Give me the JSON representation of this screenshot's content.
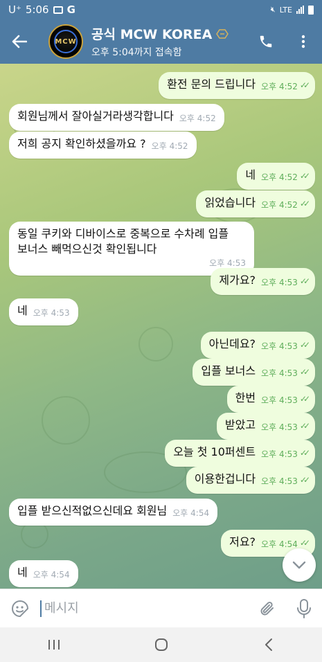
{
  "status_bar": {
    "carrier": "U⁺",
    "time": "5:06",
    "g_label": "G",
    "network": "LTE"
  },
  "header": {
    "title": "공식 MCW KOREA",
    "status": "오후 5:04까지 접속함",
    "avatar_text": "MCW",
    "accent": "#4e7ba3"
  },
  "messages": [
    {
      "dir": "out",
      "text": "환전 문의 드립니다",
      "time": "오후 4:52",
      "ticks": "✓✓"
    },
    {
      "dir": "in",
      "text": "회원님께서 잘아실거라생각합니다",
      "time": "오후 4:52"
    },
    {
      "dir": "in",
      "text": "저희 공지 확인하셨을까요 ?",
      "time": "오후 4:52"
    },
    {
      "dir": "out",
      "text": "네",
      "time": "오후 4:52",
      "ticks": "✓✓"
    },
    {
      "dir": "out",
      "text": "읽었습니다",
      "time": "오후 4:52",
      "ticks": "✓✓"
    },
    {
      "dir": "in",
      "text_line1": "동일 쿠키와 디바이스로 중복으로 수차례 입플",
      "text_line2": "보너스 빼먹으신것 확인됩니다",
      "time": "오후 4:53"
    },
    {
      "dir": "out",
      "text": "제가요?",
      "time": "오후 4:53",
      "ticks": "✓✓"
    },
    {
      "dir": "in",
      "text": "네",
      "time": "오후 4:53"
    },
    {
      "dir": "out",
      "text": "아닌데요?",
      "time": "오후 4:53",
      "ticks": "✓✓"
    },
    {
      "dir": "out",
      "text": "입플 보너스",
      "time": "오후 4:53",
      "ticks": "✓✓"
    },
    {
      "dir": "out",
      "text": "한번",
      "time": "오후 4:53",
      "ticks": "✓✓"
    },
    {
      "dir": "out",
      "text": "받았고",
      "time": "오후 4:53",
      "ticks": "✓✓"
    },
    {
      "dir": "out",
      "text": "오늘 첫 10퍼센트",
      "time": "오후 4:53",
      "ticks": "✓✓"
    },
    {
      "dir": "out",
      "text": "이용한겁니다",
      "time": "오후 4:53",
      "ticks": "✓✓"
    },
    {
      "dir": "in",
      "text": "입플 받으신적없으신데요 회원님",
      "time": "오후 4:54"
    },
    {
      "dir": "out",
      "text": "저요?",
      "time": "오후 4:54",
      "ticks": "✓✓"
    },
    {
      "dir": "in",
      "text": "네",
      "time": "오후 4:54"
    }
  ],
  "input": {
    "placeholder": "메시지"
  },
  "colors": {
    "header_bg": "#4e7ba3",
    "out_bubble": "#effdde",
    "in_bubble": "#ffffff",
    "tick_green": "#5fae5b"
  },
  "icons": {
    "back": "arrow-left-icon",
    "call": "phone-icon",
    "menu": "more-vertical-icon",
    "emoji": "sticker-icon",
    "attach": "paperclip-icon",
    "mic": "microphone-icon",
    "scroll": "chevron-down-icon"
  }
}
